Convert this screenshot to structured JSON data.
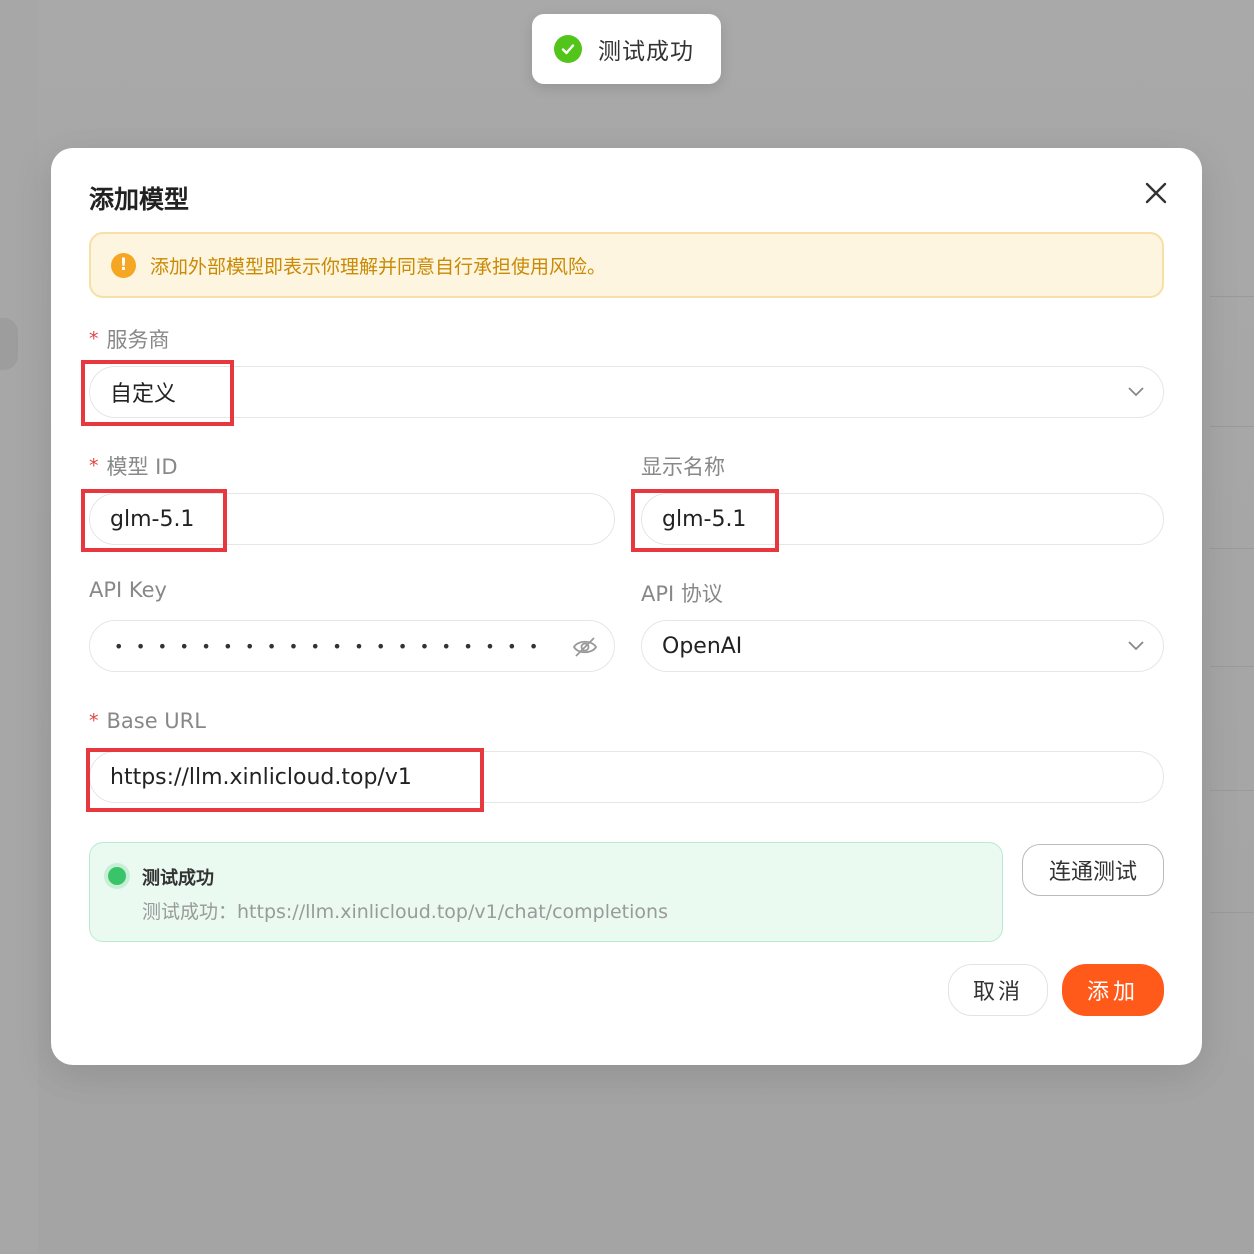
{
  "toast": {
    "text": "测试成功"
  },
  "modal": {
    "title": "添加模型",
    "warning": "添加外部模型即表示你理解并同意自行承担使用风险。",
    "provider": {
      "label": "服务商",
      "required": true,
      "value": "自定义"
    },
    "model_id": {
      "label": "模型 ID",
      "required": true,
      "value": "glm-5.1"
    },
    "display_name": {
      "label": "显示名称",
      "required": false,
      "value": "glm-5.1"
    },
    "api_key": {
      "label": "API Key",
      "masked": "••••••••••••••••••••"
    },
    "api_protocol": {
      "label": "API 协议",
      "value": "OpenAI"
    },
    "base_url": {
      "label": "Base URL",
      "required": true,
      "value": "https://llm.xinlicloud.top/v1"
    },
    "test_result": {
      "title": "测试成功",
      "detail": "测试成功：https://llm.xinlicloud.top/v1/chat/completions"
    },
    "buttons": {
      "test": "连通测试",
      "cancel": "取消",
      "add": "添加"
    }
  },
  "colors": {
    "accent": "#ff5a1a",
    "success": "#52c41a",
    "warning": "#f5a623",
    "highlight": "#e8383f"
  }
}
